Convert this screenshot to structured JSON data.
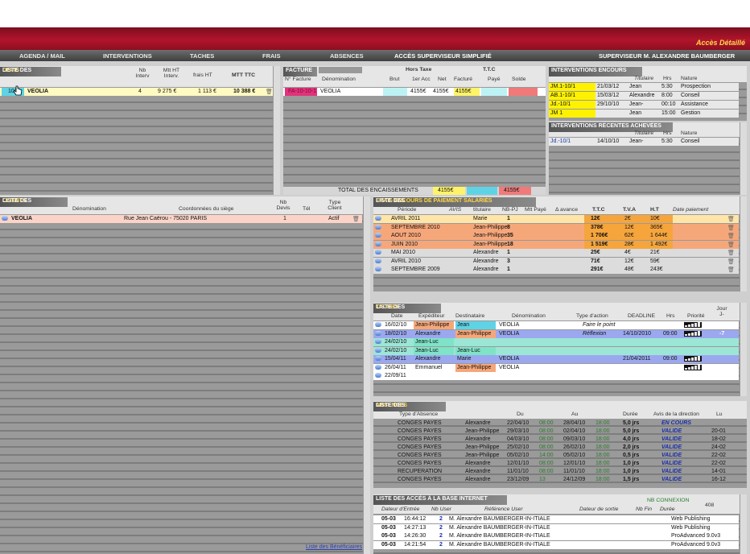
{
  "header": {
    "acces_detaille": "Accès Détaillé"
  },
  "menu": {
    "items": [
      "AGENDA / MAIL",
      "INTERVENTIONS",
      "TACHES",
      "FRAIS",
      "ABSENCES",
      "ACCÈS SUPERVISEUR SIMPLIFIÉ"
    ],
    "superviseur": "SUPERVISEUR M. ALEXANDRE BAUMBERGER"
  },
  "devis": {
    "title_a": "LISTE DES ",
    "title_b": "DEVIS",
    "headers": [
      "Nb Interv",
      "Mtt HT Interv.",
      "frais HT",
      "MTT TTC"
    ],
    "row": {
      "num": "10/1",
      "name": "VEOLIA",
      "nb": "4",
      "mtt": "9 275 €",
      "frais": "1 113 €",
      "ttc": "10 388 €"
    }
  },
  "facture": {
    "title": "FACTURE",
    "headers": {
      "hors_taxe": "Hors Taxe",
      "ttc": "T.T.C",
      "num": "N° Facture",
      "denom": "Dénomination",
      "brut": "Brut",
      "acc": "1er Acc",
      "net": "Net",
      "facture": "Facturé",
      "paye": "Payé",
      "solde": "Solde"
    },
    "row": {
      "num": "FA-10-10-1",
      "name": "VEOLIA",
      "v1": "4155€",
      "v2": "4155€",
      "v3": "4155€"
    },
    "total_label": "TOTAL DES ENCAISSEMENTS",
    "total_a": "4155€",
    "total_b": "4155€"
  },
  "interventions": {
    "title": "INTERVENTIONS ENCOURS",
    "headers": [
      "Titulaire",
      "Hrs",
      "Nature"
    ],
    "rows": [
      [
        "JM.1-10/1",
        "21/03/12",
        "Jean",
        "5:30",
        "Prospection"
      ],
      [
        "AB.1-10/1",
        "15/03/12",
        "Alexandre",
        "8:00",
        "Conseil"
      ],
      [
        "Jd.-10/1",
        "29/10/10",
        "Jean-",
        "00:10",
        "Assistance"
      ],
      [
        "JM 1",
        "",
        "Jean",
        "15:00",
        "Gestion"
      ]
    ]
  },
  "interventions_ach": {
    "title": "INTERVENTIONS RÉCENTES ACHEVÉES",
    "headers": [
      "Titulaire",
      "Hrs",
      "Nature"
    ],
    "rows": [
      [
        "Jd.-10/1",
        "14/10/10",
        "Jean-",
        "5:30",
        "Conseil"
      ]
    ]
  },
  "clients": {
    "title_a": "LISTE DES ",
    "title_b": "CLIENTS",
    "headers": [
      "Dénomination",
      "Coordonnées du siège",
      "Nb Devis",
      "Tél",
      "Type Client"
    ],
    "row": {
      "name": "VEOLIA",
      "addr": "Rue Jean Caërou - 75020 PARIS",
      "nb": "1",
      "type": "Actif"
    },
    "footer_link": "Liste des Bénéficiaires"
  },
  "frais": {
    "title_a": "LISTE DES ",
    "title_b": "FRAIS",
    "title_c": " ENCOURS DE PAIEMENT SALARIÉS",
    "headers": [
      "Période",
      "AVIS",
      "titulaire",
      "NB-PJ",
      "Mtt Payé",
      "Δ avance",
      "T.T.C",
      "T.V.A",
      "H.T",
      "Date paiement"
    ],
    "rows": [
      [
        "AVRIL 2011",
        "Marie",
        "1",
        "12€",
        "2€",
        "10€"
      ],
      [
        "SEPTEMBRE 2010",
        "Jean-Philippe",
        "8",
        "378€",
        "12€",
        "365€"
      ],
      [
        "AOUT 2010",
        "Jean-Philippe",
        "35",
        "1 706€",
        "62€",
        "1 644€"
      ],
      [
        "JUIN 2010",
        "Jean-Philippe",
        "18",
        "1 519€",
        "28€",
        "1 492€"
      ],
      [
        "MAI 2010",
        "Alexandre",
        "1",
        "25€",
        "4€",
        "21€"
      ],
      [
        "AVRIL 2010",
        "Alexandre",
        "3",
        "71€",
        "12€",
        "59€"
      ],
      [
        "SEPTEMBRE 2009",
        "Alexandre",
        "1",
        "291€",
        "48€",
        "243€"
      ]
    ]
  },
  "taches": {
    "title_a": "LISTE DES ",
    "title_b": "TACHES",
    "headers": [
      "Date",
      "Expéditeur",
      "Destinataire",
      "Dénomination",
      "Type d'action",
      "DEADLINE",
      "Hrs",
      "Priorité",
      "Jour J-"
    ],
    "rows": [
      [
        "16/02/10",
        "Jean-Philippe",
        "Jean",
        "VEOLIA",
        "Faire le point",
        "",
        "",
        "",
        ""
      ],
      [
        "18/02/10",
        "Alexandre",
        "Jean-Philippe",
        "VEOLIA",
        "Réflexion",
        "14/10/2010",
        "09:00",
        "",
        "-7"
      ],
      [
        "24/02/10",
        "Jean-Luc",
        "",
        "",
        "",
        "",
        "",
        "",
        ""
      ],
      [
        "24/02/10",
        "Jean-Luc",
        "Jean-Luc",
        "",
        "",
        "",
        "",
        "",
        ""
      ],
      [
        "15/04/11",
        "Alexandre",
        "Marie",
        "VEOLIA",
        "",
        "21/04/2011",
        "09:00",
        "",
        ""
      ],
      [
        "26/04/11",
        "Emmanuel",
        "Jean-Philippe",
        "VEOLIA",
        "",
        "",
        "",
        "",
        ""
      ],
      [
        "22/09/11",
        "",
        "",
        "",
        "",
        "",
        "",
        "",
        ""
      ]
    ]
  },
  "absences": {
    "title_a": "LISTE DES ",
    "title_b": "ABSENCES",
    "headers": [
      "Type d'Absence",
      "Du",
      "Au",
      "Durée",
      "Avis de la direction",
      "Lu"
    ],
    "rows": [
      [
        "CONGES PAYES",
        "Alexandre",
        "22/04/10",
        "08:00",
        "28/04/10",
        "18:00",
        "5,0 jrs",
        "EN COURS",
        ""
      ],
      [
        "CONGES PAYES",
        "Jean-Philippe",
        "29/03/10",
        "08:00",
        "02/04/10",
        "18:00",
        "5,0 jrs",
        "VALIDE",
        "20-01"
      ],
      [
        "CONGES PAYES",
        "Alexandre",
        "04/03/10",
        "08:00",
        "09/03/10",
        "18:00",
        "4,0 jrs",
        "VALIDE",
        "18-02"
      ],
      [
        "CONGES PAYES",
        "Jean-Philippe",
        "25/02/10",
        "08:00",
        "26/02/10",
        "18:00",
        "2,0 jrs",
        "VALIDE",
        "24-02"
      ],
      [
        "CONGES PAYES",
        "Jean-Philippe",
        "05/02/10",
        "14:00",
        "05/02/10",
        "18:00",
        "0,5 jrs",
        "VALIDE",
        "22-02"
      ],
      [
        "CONGES PAYES",
        "Alexandre",
        "12/01/10",
        "08:00",
        "12/01/10",
        "18:00",
        "1,0 jrs",
        "VALIDE",
        "22-02"
      ],
      [
        "RECUPERATION",
        "Alexandre",
        "11/01/10",
        "08:00",
        "11/01/10",
        "18:00",
        "1,0 jrs",
        "VALIDE",
        "14-01"
      ],
      [
        "CONGES PAYES",
        "Alexandre",
        "23/12/09",
        "13",
        "24/12/09",
        "18:00",
        "1,5 jrs",
        "VALIDE",
        "16-12"
      ]
    ]
  },
  "acces": {
    "title": "LISTE DES ACCÈS À LA BASE INTERNET",
    "nb_label": "NB CONNEXION",
    "nb": "408",
    "headers": [
      "Dateur d'Entrée",
      "Nb User",
      "Référence User",
      "Dateur de sortie",
      "Nb Fin",
      "Durée"
    ],
    "rows": [
      [
        "05-03",
        "16:44:12",
        "2",
        "M. Alexandre BAUMBERGER-IN-ITIALE",
        "Web Publishing"
      ],
      [
        "05-03",
        "14:27:13",
        "2",
        "M. Alexandre BAUMBERGER-IN-ITIALE",
        "Web Publishing"
      ],
      [
        "05-03",
        "14:26:30",
        "2",
        "M. Alexandre BAUMBERGER-IN-ITIALE",
        "ProAdvanced 9.0v3"
      ],
      [
        "05-03",
        "14:21:54",
        "2",
        "M. Alexandre BAUMBERGER-IN-ITIALE",
        "ProAdvanced 9.0v3"
      ]
    ]
  }
}
